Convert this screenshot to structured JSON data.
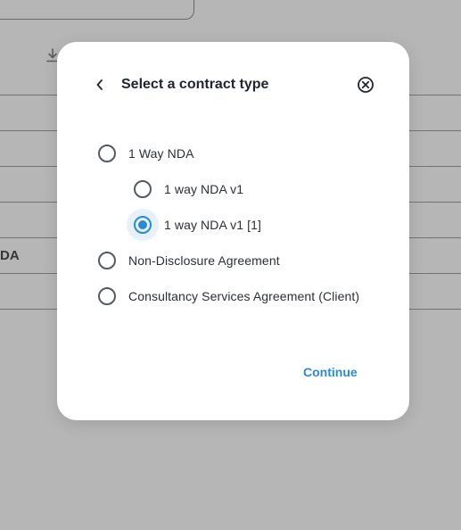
{
  "background": {
    "partial_text": "DA"
  },
  "modal": {
    "title": "Select a contract type",
    "back_icon": "chevron-left-icon",
    "close_icon": "close-circle-icon",
    "accent_color": "#2a8ad6",
    "options": [
      {
        "label": "1 Way NDA",
        "selected": false,
        "level": 0
      },
      {
        "label": "1 way NDA v1",
        "selected": false,
        "level": 1
      },
      {
        "label": "1 way NDA v1 [1]",
        "selected": true,
        "level": 1
      },
      {
        "label": "Non-Disclosure Agreement",
        "selected": false,
        "level": 0
      },
      {
        "label": "Consultancy Services Agreement (Client)",
        "selected": false,
        "level": 0
      }
    ],
    "continue_label": "Continue"
  }
}
